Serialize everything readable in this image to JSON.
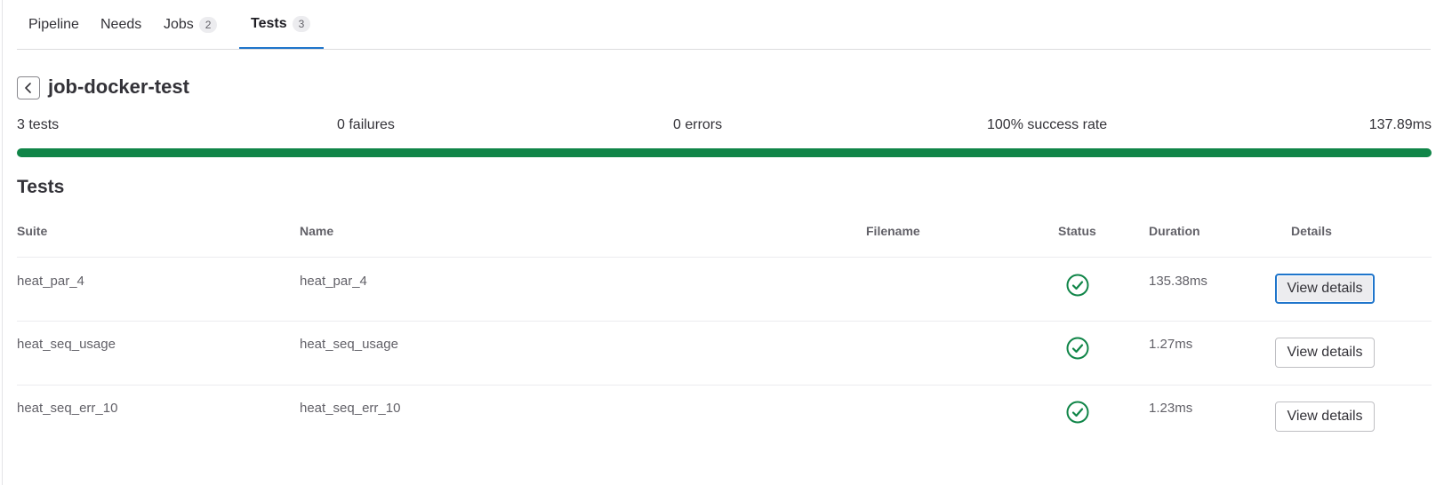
{
  "tabs": [
    {
      "label": "Pipeline"
    },
    {
      "label": "Needs"
    },
    {
      "label": "Jobs",
      "count": "2"
    },
    {
      "label": "Tests",
      "count": "3",
      "active": true
    }
  ],
  "job": {
    "title": "job-docker-test"
  },
  "summary": {
    "tests": "3 tests",
    "failures": "0 failures",
    "errors": "0 errors",
    "success_rate": "100% success rate",
    "duration": "137.89ms",
    "progress_fraction": 1.0,
    "progress_color": "#108548"
  },
  "section": {
    "title": "Tests"
  },
  "table": {
    "headers": {
      "suite": "Suite",
      "name": "Name",
      "filename": "Filename",
      "status": "Status",
      "duration": "Duration",
      "details": "Details"
    },
    "rows": [
      {
        "suite": "heat_par_4",
        "name": "heat_par_4",
        "filename": "",
        "status": "success",
        "duration": "135.38ms",
        "button": "View details"
      },
      {
        "suite": "heat_seq_usage",
        "name": "heat_seq_usage",
        "filename": "",
        "status": "success",
        "duration": "1.27ms",
        "button": "View details"
      },
      {
        "suite": "heat_seq_err_10",
        "name": "heat_seq_err_10",
        "filename": "",
        "status": "success",
        "duration": "1.23ms",
        "button": "View details"
      }
    ]
  },
  "colors": {
    "accent": "#1f75cb",
    "success": "#108548"
  },
  "icons": {
    "back": "chevron-left-icon",
    "status": "check-circle-icon"
  }
}
